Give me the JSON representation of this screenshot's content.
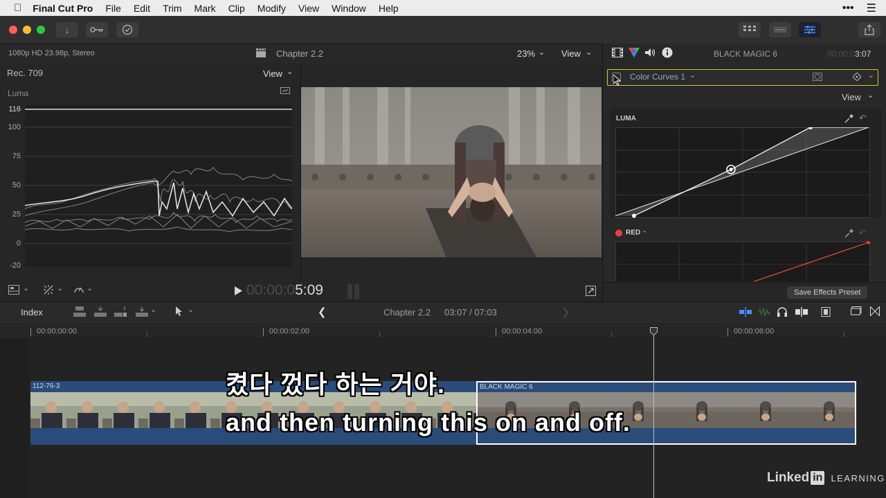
{
  "menubar": {
    "app_name": "Final Cut Pro",
    "items": [
      "File",
      "Edit",
      "Trim",
      "Mark",
      "Clip",
      "Modify",
      "View",
      "Window",
      "Help"
    ]
  },
  "toolbar": {
    "import_icon": "download-icon",
    "keyword_icon": "key-icon",
    "analyze_icon": "checkmark-circle-icon",
    "window_buttons": [
      "browser-grid-icon",
      "timeline-icon",
      "inspector-sliders-icon"
    ],
    "share_icon": "share-icon"
  },
  "viewer_header": {
    "format": "1080p HD 23.98p, Stereo",
    "title": "Chapter 2.2",
    "zoom": "23%",
    "view_label": "View"
  },
  "scopes": {
    "colorspace": "Rec. 709",
    "view_label": "View",
    "scope_type": "Luma",
    "y_labels": [
      "116",
      "100",
      "75",
      "50",
      "25",
      "0",
      "-20"
    ]
  },
  "viewer_controls": {
    "timecode_dim": "00:00:0",
    "timecode_bright": "5:09"
  },
  "inspector": {
    "clip_name": "BLACK MAGIC 6",
    "duration_dim": "00:00:0",
    "duration_bright": "3:07",
    "effect_name": "Color Curves 1",
    "view_label": "View",
    "luma_label": "LUMA",
    "red_label": "RED",
    "save_preset": "Save Effects Preset"
  },
  "timeline_header": {
    "index_label": "Index",
    "title": "Chapter 2.2",
    "position": "03:07 / 07:03"
  },
  "timeline": {
    "ruler": [
      "00:00:00:00",
      "00:00:02:00",
      "00:00:04:00",
      "00:00:06:00"
    ],
    "clip1_name": "112-76-3",
    "clip2_name": "BLACK MAGIC 6"
  },
  "subtitles": {
    "line1": "켰다 껐다 하는 거야.",
    "line2": "and then turning this on and off."
  },
  "watermark": {
    "brand": "Linked",
    "brand_box": "in",
    "learning": "LEARNING"
  },
  "colors": {
    "accent_blue": "#4a8dff",
    "selection_yellow": "#d8c33a",
    "red_curve": "#e0443e",
    "clip_blue": "#2a4c7a"
  }
}
